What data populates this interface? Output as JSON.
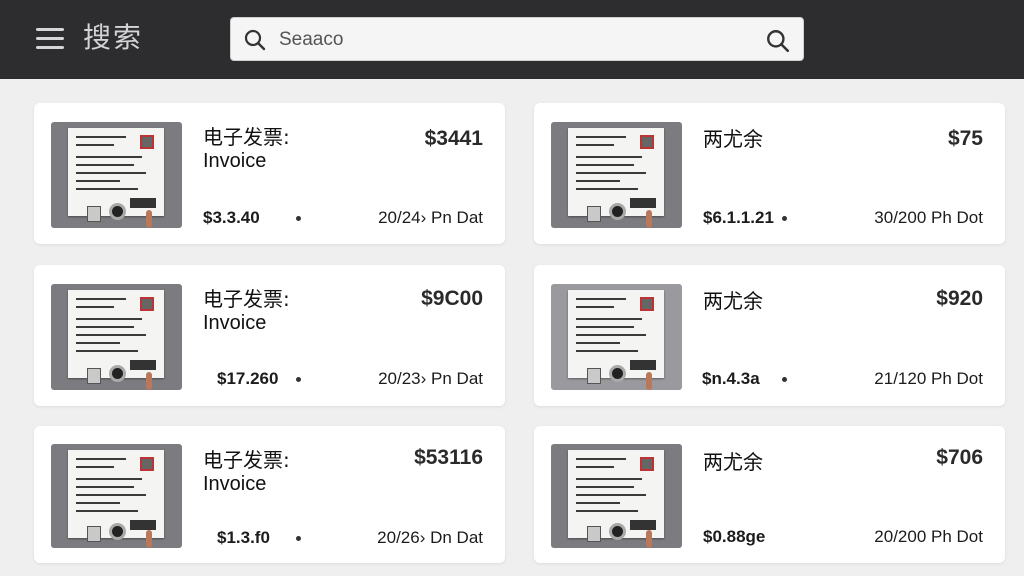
{
  "header": {
    "title": "搜索",
    "search_placeholder": "Seaaco"
  },
  "cards": [
    {
      "title": "电子发票:",
      "subtitle": "Invoice",
      "amount": "$3441",
      "sub_amount": "$3.3.40",
      "date": "20/24› Pn Dat"
    },
    {
      "title": "两尤余",
      "subtitle": "",
      "amount": "$75",
      "sub_amount": "$6.1.1.21",
      "date": "30/200 Ph Dot"
    },
    {
      "title": "电子发票:",
      "subtitle": "Invoice",
      "amount": "$9C00",
      "sub_amount": "$17.260",
      "date": "20/23› Pn Dat"
    },
    {
      "title": "两尤余",
      "subtitle": "",
      "amount": "$920",
      "sub_amount": "$n.4.3a",
      "date": "21/120 Ph Dot"
    },
    {
      "title": "电子发票:",
      "subtitle": "Invoice",
      "amount": "$53116",
      "sub_amount": "$1.3.f0",
      "date": "20/26› Dn Dat"
    },
    {
      "title": "两尤余",
      "subtitle": "",
      "amount": "$706",
      "sub_amount": "$0.88ge",
      "date": "20/200 Ph Dot"
    }
  ]
}
